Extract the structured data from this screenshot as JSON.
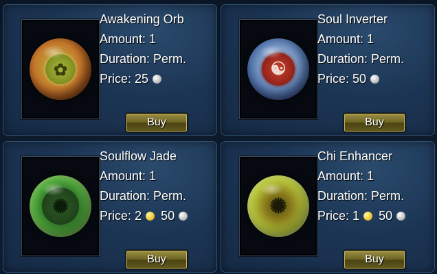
{
  "shop": {
    "items": [
      {
        "name": "Awakening Orb",
        "amount": "Amount: 1",
        "duration": "Duration: Perm.",
        "price_label": "Price:",
        "gold": "",
        "silver": "25",
        "icon": "awakening-orb-icon",
        "buy_label": "Buy"
      },
      {
        "name": "Soul Inverter",
        "amount": "Amount: 1",
        "duration": "Duration: Perm.",
        "price_label": "Price:",
        "gold": "",
        "silver": "50",
        "icon": "soul-inverter-icon",
        "buy_label": "Buy"
      },
      {
        "name": "Soulflow Jade",
        "amount": "Amount: 1",
        "duration": "Duration: Perm.",
        "price_label": "Price:",
        "gold": "2",
        "silver": "50",
        "icon": "soulflow-jade-icon",
        "buy_label": "Buy"
      },
      {
        "name": "Chi Enhancer",
        "amount": "Amount: 1",
        "duration": "Duration: Perm.",
        "price_label": "Price:",
        "gold": "1",
        "silver": "50",
        "icon": "chi-enhancer-icon",
        "buy_label": "Buy"
      }
    ]
  },
  "colors": {
    "panel": "#1c3554",
    "gold_coin": "#f2c93a",
    "silver_coin": "#c4c4c4",
    "button": "#6f6524"
  }
}
